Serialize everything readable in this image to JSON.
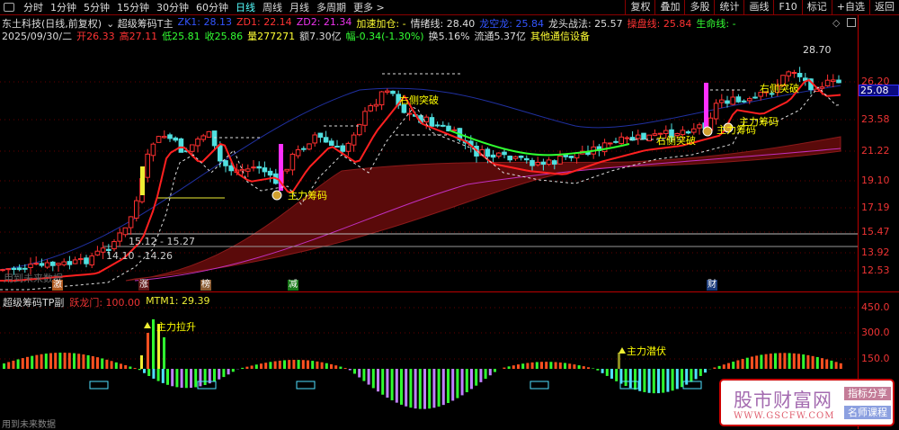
{
  "toolbar": {
    "tabs": [
      "分时",
      "1分钟",
      "5分钟",
      "15分钟",
      "30分钟",
      "60分钟",
      "日线",
      "周线",
      "月线",
      "多周期",
      "更多 >"
    ],
    "active": 6,
    "right_buttons": [
      "复权",
      "叠加",
      "多股",
      "统计",
      "画线",
      "F10",
      "标记",
      "+自选",
      "返回"
    ]
  },
  "info1": [
    {
      "text": "东土科技(日线,前复权)",
      "color": "#dddddd"
    },
    {
      "text": "⌄ 超级筹码T主",
      "color": "#dddddd"
    },
    {
      "text": "ZK1: 28.13",
      "color": "#3355ff"
    },
    {
      "text": "ZD1: 22.14",
      "color": "#ff3333"
    },
    {
      "text": "ZD2: 21.34",
      "color": "#ee33ee"
    },
    {
      "text": "加速加仓: -",
      "color": "#ffff33"
    },
    {
      "text": "情绪线: 28.40",
      "color": "#dddddd"
    },
    {
      "text": "龙空龙: 25.84",
      "color": "#3355ff"
    },
    {
      "text": "龙头战法: 25.57",
      "color": "#dddddd"
    },
    {
      "text": "操盘线: 25.84",
      "color": "#ff3333"
    },
    {
      "text": "生命线: -",
      "color": "#33ff33"
    }
  ],
  "info2": [
    {
      "text": "2025/09/30/二",
      "color": "#dddddd"
    },
    {
      "text": "开26.33",
      "color": "#ff3333"
    },
    {
      "text": "高27.11",
      "color": "#ff3333"
    },
    {
      "text": "低25.81",
      "color": "#33ff33"
    },
    {
      "text": "收25.86",
      "color": "#33ff33"
    },
    {
      "text": "量277271",
      "color": "#ffff33"
    },
    {
      "text": "额7.30亿",
      "color": "#dddddd"
    },
    {
      "text": "幅-0.34(-1.30%)",
      "color": "#33ff33"
    },
    {
      "text": "换5.16%",
      "color": "#dddddd"
    },
    {
      "text": "流通5.37亿",
      "color": "#dddddd"
    },
    {
      "text": "其他通信设备",
      "color": "#ffff33"
    }
  ],
  "price_axis": [
    "26.20",
    "23.58",
    "21.22",
    "19.10",
    "17.19",
    "15.47",
    "13.92",
    "12.53"
  ],
  "current_price": "25.08",
  "peak_label": "28.70",
  "annotations": {
    "breakout": "右侧突破",
    "chips": "主力筹码",
    "range1": "15.12 - 15.27",
    "range2": "14.10 - 14.26",
    "future_top": "用到未来数据"
  },
  "markers": [
    "激",
    "涨",
    "榜",
    "减",
    "财"
  ],
  "sub": {
    "title": "超级筹码TP副",
    "ylm": "跃龙门: 100.00",
    "mtm": "MTM1: 29.39",
    "axis": [
      "450.0",
      "300.0",
      "150.0"
    ],
    "lift": "主力拉升",
    "lurk": "主力潜伏",
    "future": "用到未来数据"
  },
  "watermark": {
    "name": "股市财富网",
    "url": "WWW.GSCFW.COM",
    "b1": "指标分享",
    "b2": "名师课程"
  }
}
